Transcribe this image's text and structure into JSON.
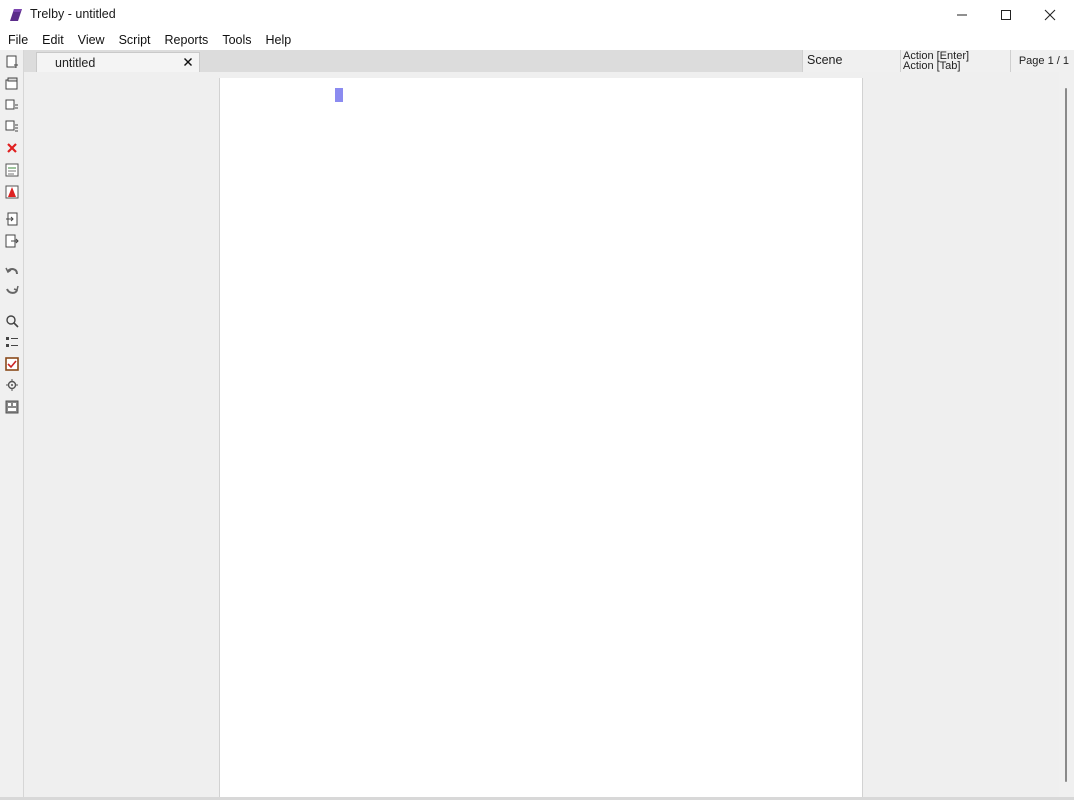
{
  "window": {
    "title": "Trelby - untitled"
  },
  "menu": [
    {
      "label": "File"
    },
    {
      "label": "Edit"
    },
    {
      "label": "View"
    },
    {
      "label": "Script"
    },
    {
      "label": "Reports"
    },
    {
      "label": "Tools"
    },
    {
      "label": "Help"
    }
  ],
  "toolbar": {
    "icons": [
      "new-script-icon",
      "open-icon",
      "save-icon",
      "save-as-icon",
      "close-script-icon",
      "import-icon",
      "export-pdf-icon",
      "import-text-icon",
      "export-text-icon",
      "undo-icon",
      "redo-icon",
      "find-icon",
      "settings-list-icon",
      "check-script-icon",
      "settings-icon",
      "character-map-icon"
    ]
  },
  "tabs": [
    {
      "label": "untitled",
      "close": "✕"
    }
  ],
  "status": {
    "scene": "Scene",
    "action_enter": "Action [Enter]",
    "action_tab": "Action [Tab]",
    "page": "Page 1 / 1"
  },
  "colors": {
    "cursor": "#8b8bf0",
    "app_icon": "#5b2c8a",
    "close_icon": "#e02020"
  }
}
